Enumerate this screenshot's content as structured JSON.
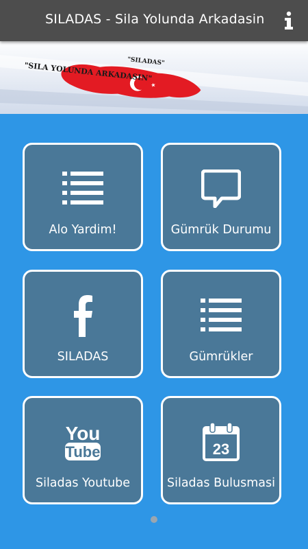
{
  "app": {
    "title": "SILADAS - Sila Yolunda Arkadasin",
    "info_icon": "info-icon"
  },
  "banner": {
    "top_text": "\"SILADAS\"",
    "bottom_text": "\"SILA YOLUNDA ARKADASIN\"",
    "flag_color": "#e31b23"
  },
  "tiles": [
    {
      "label": "Alo Yardim!",
      "icon": "list-icon"
    },
    {
      "label": "Gümrük Durumu",
      "icon": "chat-bubble-icon"
    },
    {
      "label": "SILADAS",
      "icon": "facebook-icon"
    },
    {
      "label": "Gümrükler",
      "icon": "list-icon"
    },
    {
      "label": "Siladas Youtube",
      "icon": "youtube-icon",
      "icon_text_top": "You",
      "icon_text_bottom": "Tube"
    },
    {
      "label": "Siladas Bulusmasi",
      "icon": "calendar-icon",
      "icon_text": "23"
    }
  ],
  "pager": {
    "pages": 1,
    "current": 1
  },
  "colors": {
    "titlebar": "#4d4d4d",
    "background": "#2e96e6",
    "tile": "#4a7898",
    "tile_border": "#ffffff"
  }
}
